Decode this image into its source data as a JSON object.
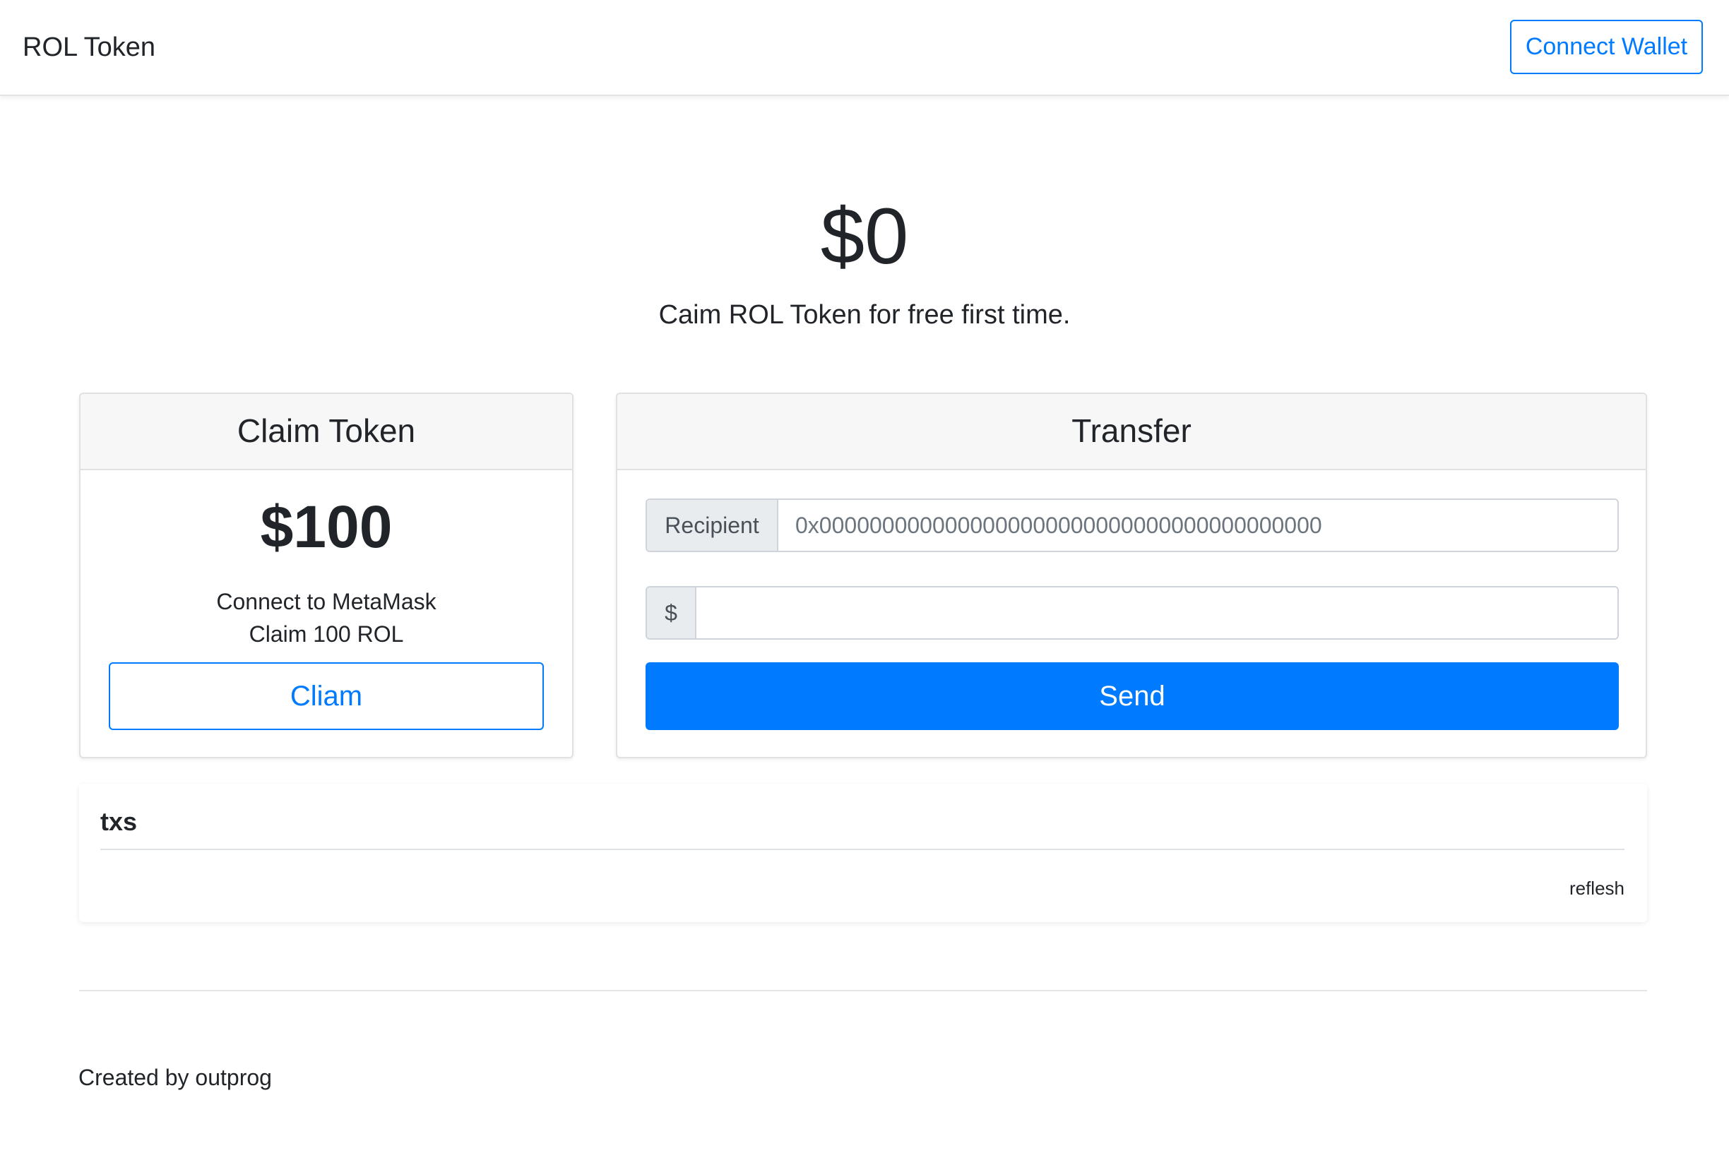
{
  "navbar": {
    "brand": "ROL Token",
    "connect_label": "Connect Wallet"
  },
  "hero": {
    "balance": "$0",
    "lead": "Caim ROL Token for free first time."
  },
  "claim_card": {
    "title": "Claim Token",
    "amount": "$100",
    "line1": "Connect to MetaMask",
    "line2": "Claim 100 ROL",
    "button_label": "Cliam"
  },
  "transfer_card": {
    "title": "Transfer",
    "recipient_label": "Recipient",
    "recipient_placeholder": "0x0000000000000000000000000000000000000000",
    "amount_prefix": "$",
    "amount_value": "",
    "send_label": "Send"
  },
  "txs": {
    "title": "txs",
    "refresh_label": "reflesh"
  },
  "footer": {
    "text": "Created by outprog"
  },
  "colors": {
    "primary": "#007bff",
    "text": "#212529",
    "card_header_bg": "#f7f7f7",
    "addon_bg": "#e9ecef"
  }
}
